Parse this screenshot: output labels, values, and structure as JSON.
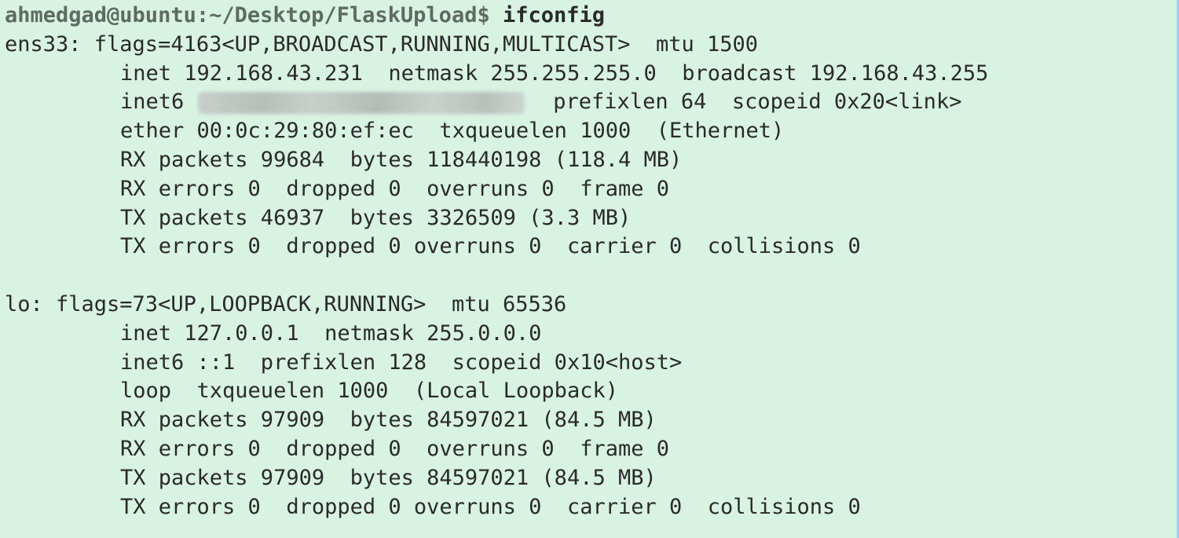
{
  "prompt": {
    "user_host_path": "ahmedgad@ubuntu:~/Desktop/FlaskUpload$",
    "command": "ifconfig"
  },
  "colors": {
    "background": "#d9f3e3",
    "prompt": "#5d6b63",
    "text": "#2a2a2a",
    "edge": "#9fd6ec"
  },
  "interfaces": [
    {
      "header": "ens33: flags=4163<UP,BROADCAST,RUNNING,MULTICAST>  mtu 1500",
      "inet": "inet 192.168.43.231  netmask 255.255.255.0  broadcast 192.168.43.255",
      "inet6_label": "inet6",
      "inet6_rest": "prefixlen 64  scopeid 0x20<link>",
      "link": "ether 00:0c:29:80:ef:ec  txqueuelen 1000  (Ethernet)",
      "rx_packets": "RX packets 99684  bytes 118440198 (118.4 MB)",
      "rx_errors": "RX errors 0  dropped 0  overruns 0  frame 0",
      "tx_packets": "TX packets 46937  bytes 3326509 (3.3 MB)",
      "tx_errors": "TX errors 0  dropped 0 overruns 0  carrier 0  collisions 0"
    },
    {
      "header": "lo: flags=73<UP,LOOPBACK,RUNNING>  mtu 65536",
      "inet": "inet 127.0.0.1  netmask 255.0.0.0",
      "inet6": "inet6 ::1  prefixlen 128  scopeid 0x10<host>",
      "link": "loop  txqueuelen 1000  (Local Loopback)",
      "rx_packets": "RX packets 97909  bytes 84597021 (84.5 MB)",
      "rx_errors": "RX errors 0  dropped 0  overruns 0  frame 0",
      "tx_packets": "TX packets 97909  bytes 84597021 (84.5 MB)",
      "tx_errors": "TX errors 0  dropped 0 overruns 0  carrier 0  collisions 0"
    }
  ]
}
